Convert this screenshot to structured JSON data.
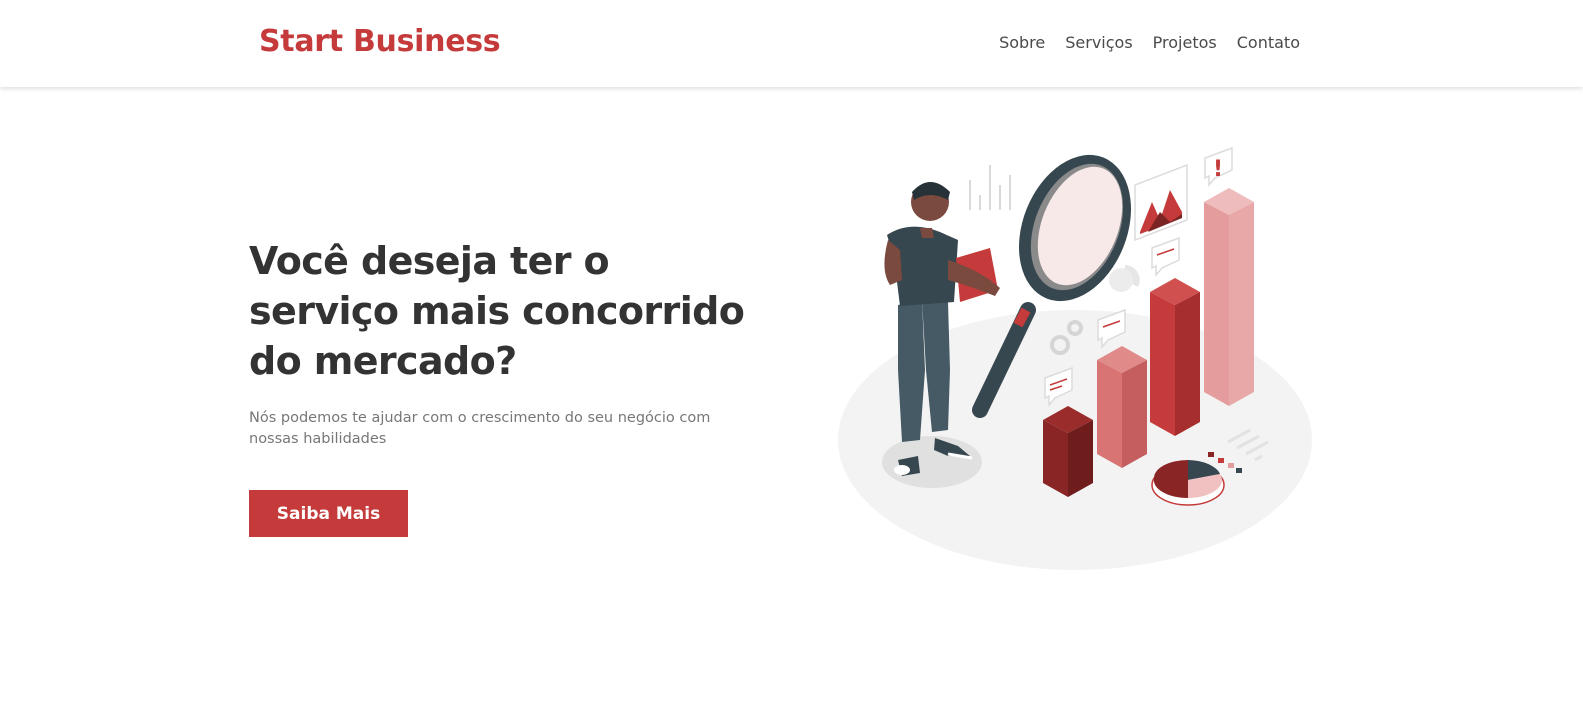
{
  "header": {
    "brand": "Start Business",
    "nav": [
      "Sobre",
      "Serviços",
      "Projetos",
      "Contato"
    ]
  },
  "hero": {
    "title": "Você deseja ter o serviço mais concorrido do mercado?",
    "subtitle": "Nós podemos te ajudar com o crescimento do seu negócio com nossas habilidades",
    "cta_label": "Saiba Mais"
  },
  "theme": {
    "accent": "#c53a3a",
    "text_dark": "#333333",
    "text_muted": "#777777"
  },
  "illustration": {
    "name": "person-with-magnifier-analytics-illustration"
  }
}
